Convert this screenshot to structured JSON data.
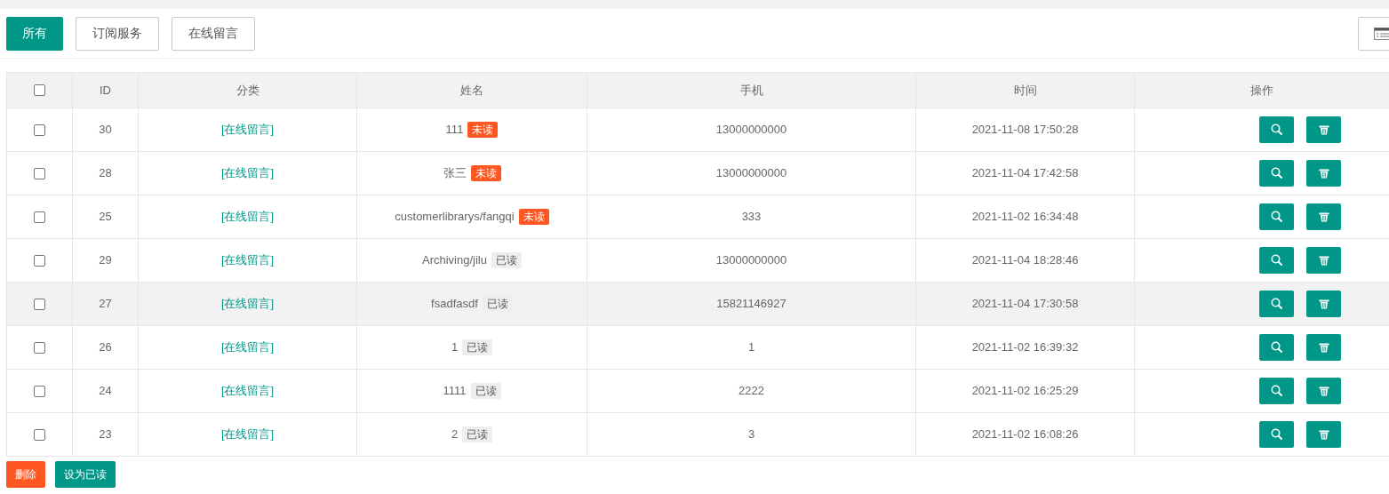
{
  "filters": [
    {
      "label": "所有",
      "selected": true
    },
    {
      "label": "订阅服务",
      "selected": false
    },
    {
      "label": "在线留言",
      "selected": false
    }
  ],
  "table": {
    "select_all": {
      "checked": false
    },
    "columns": [
      "ID",
      "分类",
      "姓名",
      "手机",
      "时间",
      "操作"
    ],
    "rows": [
      {
        "checked": false,
        "highlighted": false,
        "id": "30",
        "category": "[在线留言]",
        "name": "111",
        "status": {
          "read": false,
          "label": "未读"
        },
        "phone": "13000000000",
        "time": "2021-11-08 17:50:28"
      },
      {
        "checked": false,
        "highlighted": false,
        "id": "28",
        "category": "[在线留言]",
        "name": "张三",
        "status": {
          "read": false,
          "label": "未读"
        },
        "phone": "13000000000",
        "time": "2021-11-04 17:42:58"
      },
      {
        "checked": false,
        "highlighted": false,
        "id": "25",
        "category": "[在线留言]",
        "name": "customerlibrarys/fangqi",
        "status": {
          "read": false,
          "label": "未读"
        },
        "phone": "333",
        "time": "2021-11-02 16:34:48"
      },
      {
        "checked": false,
        "highlighted": false,
        "id": "29",
        "category": "[在线留言]",
        "name": "Archiving/jilu",
        "status": {
          "read": true,
          "label": "已读"
        },
        "phone": "13000000000",
        "time": "2021-11-04 18:28:46"
      },
      {
        "checked": false,
        "highlighted": true,
        "id": "27",
        "category": "[在线留言]",
        "name": "fsadfasdf",
        "status": {
          "read": true,
          "label": "已读"
        },
        "phone": "15821146927",
        "time": "2021-11-04 17:30:58"
      },
      {
        "checked": false,
        "highlighted": false,
        "id": "26",
        "category": "[在线留言]",
        "name": "1",
        "status": {
          "read": true,
          "label": "已读"
        },
        "phone": "1",
        "time": "2021-11-02 16:39:32"
      },
      {
        "checked": false,
        "highlighted": false,
        "id": "24",
        "category": "[在线留言]",
        "name": "1111",
        "status": {
          "read": true,
          "label": "已读"
        },
        "phone": "2222",
        "time": "2021-11-02 16:25:29"
      },
      {
        "checked": false,
        "highlighted": false,
        "id": "23",
        "category": "[在线留言]",
        "name": "2",
        "status": {
          "read": true,
          "label": "已读"
        },
        "phone": "3",
        "time": "2021-11-02 16:08:26"
      }
    ]
  },
  "bulk_actions": [
    {
      "kind": "danger",
      "label": "删除"
    },
    {
      "kind": "primary",
      "label": "设为已读"
    }
  ]
}
